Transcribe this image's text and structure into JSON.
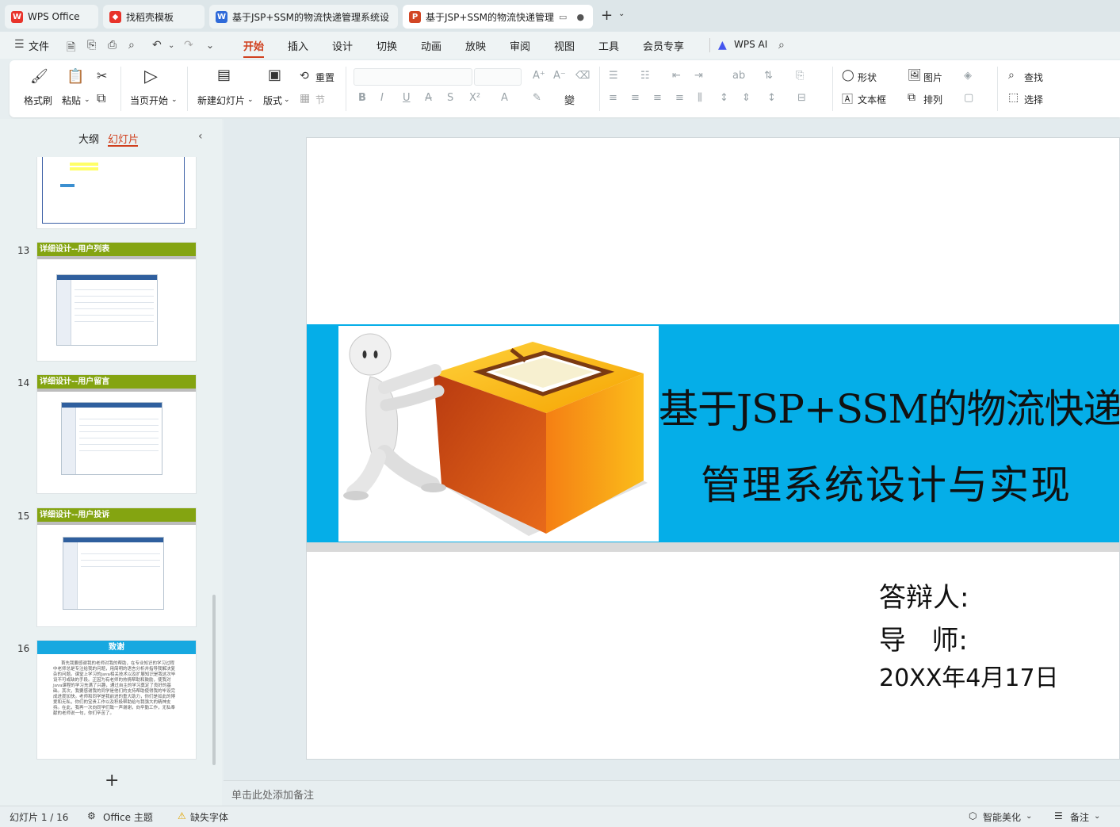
{
  "tabs": [
    {
      "label": "WPS Office",
      "icon": "wps-logo-icon"
    },
    {
      "label": "找稻壳模板",
      "icon": "docer-icon"
    },
    {
      "label": "基于JSP+SSM的物流快递管理系统设",
      "icon": "word-doc-icon"
    },
    {
      "label": "基于JSP+SSM的物流快递管理",
      "icon": "ppt-doc-icon"
    }
  ],
  "menu": {
    "file": "文件",
    "items": [
      "开始",
      "插入",
      "设计",
      "切换",
      "动画",
      "放映",
      "审阅",
      "视图",
      "工具",
      "会员专享"
    ],
    "active": "开始",
    "wps_ai": "WPS AI"
  },
  "ribbon": {
    "format_painter": "格式刷",
    "paste": "粘贴",
    "from_start": "当页开始",
    "new_slide": "新建幻灯片",
    "layout": "版式",
    "reset": "重置",
    "section": "节",
    "shape": "形状",
    "picture": "图片",
    "textbox": "文本框",
    "arrange": "排列",
    "find": "查找",
    "select": "选择"
  },
  "left_panel": {
    "tab_outline": "大纲",
    "tab_slides": "幻灯片",
    "active_tab": "幻灯片",
    "thumbs": [
      {
        "num": "13",
        "header": "详细设计--用户列表"
      },
      {
        "num": "14",
        "header": "详细设计--用户留言"
      },
      {
        "num": "15",
        "header": "详细设计--用户投诉"
      },
      {
        "num": "16",
        "header": "致谢",
        "body": "首先我要感谢我的老师对我的帮助，在专业知识的学习过程中老师总是专注给我的问题，用简明的语言分析并指导我解决复杂的问题。课堂上学习的java相关技术以及扩展知识是我这次毕设不可或缺的手段。正因为有老师的热情帮助和鼓励，使我对java课程的学习充满了兴趣，通过自主的学习奠定了良好的基础。其次，我要感谢我的同学是他们的支持帮助使得我的毕设完成进度加快。老师和同学是我前进的重大助力，你们是如此的博爱和无私，你们的宝贵工作以及积极帮助给与我强大的精神支持。在此，我再一次向同学们致一声谢谢，向辛勤工作，无私奉献的老师说一句，你们辛苦了。"
      }
    ],
    "add_label": "+"
  },
  "slide": {
    "title_line1": "基于JSP+SSM的物流快递",
    "title_line2": "管理系统设计与实现",
    "defender": "答辩人:",
    "advisor": "导   师:",
    "date": "20XX年4月17日"
  },
  "notes_placeholder": "单击此处添加备注",
  "status": {
    "slide_counter": "幻灯片 1 / 16",
    "theme": "Office 主题",
    "missing_font": "缺失字体",
    "beautify": "智能美化",
    "notes": "备注"
  },
  "colors": {
    "accent": "#d0401e",
    "banner": "#05aee8",
    "thumb_header_green": "#84a411",
    "thumb_header_blue": "#17a8e0"
  }
}
